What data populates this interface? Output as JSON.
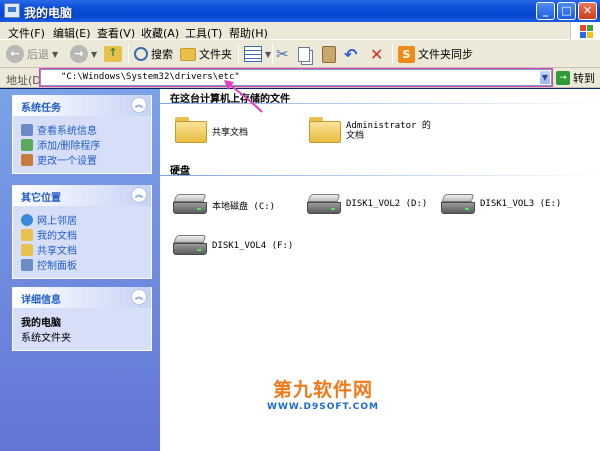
{
  "window": {
    "title": "我的电脑"
  },
  "menu": [
    "文件(F)",
    "编辑(E)",
    "查看(V)",
    "收藏(A)",
    "工具(T)",
    "帮助(H)"
  ],
  "toolbar": {
    "back_label": "后退",
    "search_label": "搜索",
    "folders_label": "文件夹",
    "sync_label": "文件夹同步"
  },
  "address": {
    "label": "地址(D)",
    "value": "\"C:\\Windows\\System32\\drivers\\etc\"",
    "go_label": "转到"
  },
  "left_panel": {
    "system_tasks": {
      "title": "系统任务",
      "items": [
        "查看系统信息",
        "添加/删除程序",
        "更改一个设置"
      ]
    },
    "other_places": {
      "title": "其它位置",
      "items": [
        "网上邻居",
        "我的文档",
        "共享文档",
        "控制面板"
      ]
    },
    "details": {
      "title": "详细信息",
      "name": "我的电脑",
      "type": "系统文件夹"
    }
  },
  "content": {
    "files_group": "在这台计算机上存储的文件",
    "files": [
      "共享文档",
      "Administrator 的文档"
    ],
    "disks_group": "硬盘",
    "disks": [
      "本地磁盘 (C:)",
      "DISK1_VOL2 (D:)",
      "DISK1_VOL3 (E:)",
      "DISK1_VOL4 (F:)"
    ]
  },
  "watermark": {
    "line1": "第九软件网",
    "line2": "WWW.D9SOFT.COM"
  },
  "colors": {
    "titlebar": "#0b4fd8",
    "panel_link": "#215dc6",
    "address_highlight": "#e040c0"
  }
}
